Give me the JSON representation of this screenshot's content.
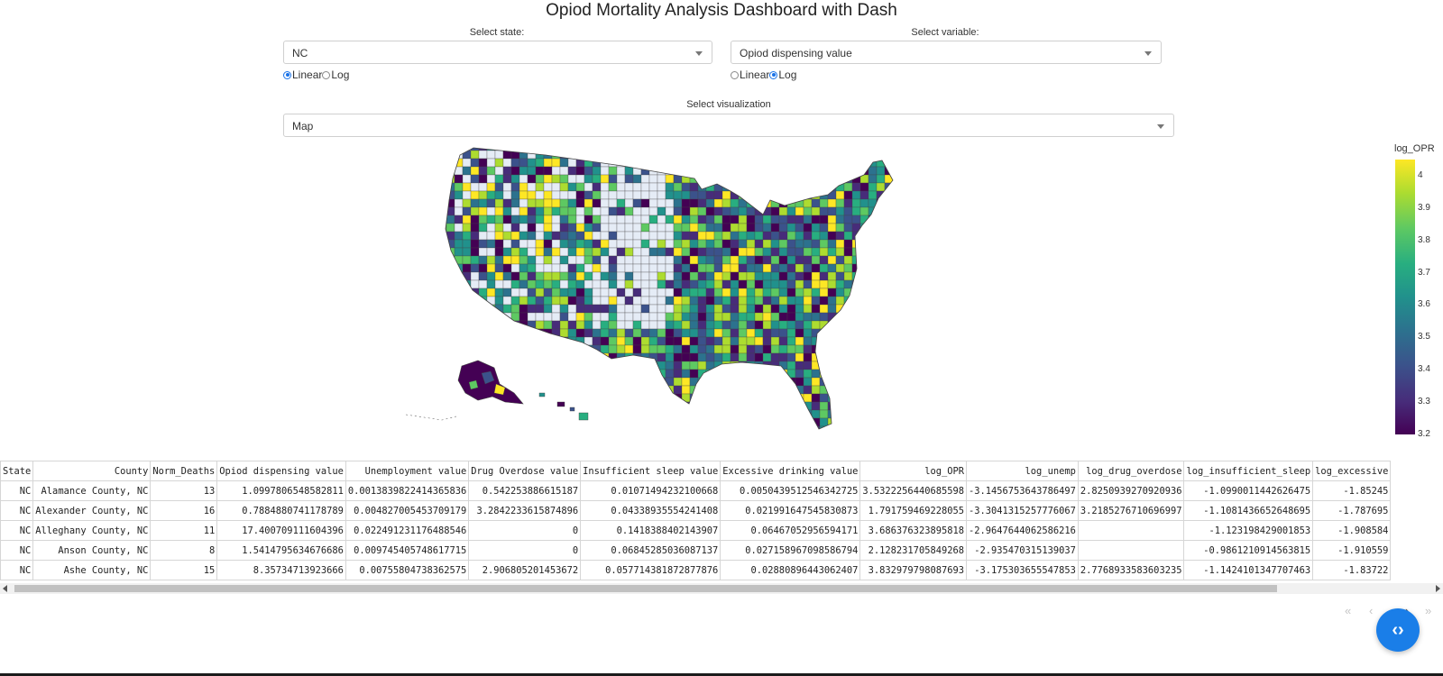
{
  "title": "Opiod Mortality Analysis Dashboard with Dash",
  "controls": {
    "state_label": "Select state:",
    "state_value": "NC",
    "variable_label": "Select variable:",
    "variable_value": "Opiod dispensing value",
    "state_scale": {
      "options": [
        "Linear",
        "Log"
      ],
      "selected": "Linear"
    },
    "variable_scale": {
      "options": [
        "Linear",
        "Log"
      ],
      "selected": "Log"
    },
    "viz_label": "Select visualization",
    "viz_value": "Map"
  },
  "map": {
    "type": "choropleth",
    "colorscale": "Viridis",
    "colorbar": {
      "title": "log_OPR",
      "ticks": [
        "4",
        "3.9",
        "3.8",
        "3.7",
        "3.6",
        "3.5",
        "3.4",
        "3.3",
        "3.2"
      ],
      "range": [
        3.2,
        4.05
      ]
    },
    "missing_color": "#e5ecf6",
    "border_color": "#444444"
  },
  "table": {
    "columns": [
      "State",
      "County",
      "Norm_Deaths",
      "Opiod dispensing value",
      "Unemployment value",
      "Drug Overdose value",
      "Insufficient sleep value",
      "Excessive drinking value",
      "log_OPR",
      "log_unemp",
      "log_drug_overdose",
      "log_insufficient_sleep",
      "log_excessive"
    ],
    "rows": [
      [
        "NC",
        "Alamance County, NC",
        "13",
        "1.0997806548582811",
        "0.0013839822414365836",
        "0.542253886615187",
        "0.01071494232100668",
        "0.0050439512546342725",
        "3.5322256440685598",
        "-3.1456753643786497",
        "2.8250939270920936",
        "-1.0990011442626475",
        "-1.85245"
      ],
      [
        "NC",
        "Alexander County, NC",
        "16",
        "0.7884880741178789",
        "0.004827005453709179",
        "3.2842233615874896",
        "0.04338935554241408",
        "0.021991647545830873",
        "1.791759469228055",
        "-3.3041315257776067",
        "3.2185276710696997",
        "-1.1081436652648695",
        "-1.787695"
      ],
      [
        "NC",
        "Alleghany County, NC",
        "11",
        "17.400709111604396",
        "0.022491231176488546",
        "0",
        "0.1418388402143907",
        "0.06467052956594171",
        "3.686376323895818",
        "-2.9647644062586216",
        "",
        "-1.123198429001853",
        "-1.908584"
      ],
      [
        "NC",
        "Anson County, NC",
        "8",
        "1.5414795634676686",
        "0.009745405748617715",
        "0",
        "0.06845285036087137",
        "0.027158967098586794",
        "2.128231705849268",
        "-2.935470315139037",
        "",
        "-0.9861210914563815",
        "-1.910559"
      ],
      [
        "NC",
        "Ashe County, NC",
        "15",
        "8.35734713923666",
        "0.00755804738362575",
        "2.906805201453672",
        "0.057714381872877876",
        "0.02880896443062407",
        "3.832979798087693",
        "-3.175303655547853",
        "2.7768933583603235",
        "-1.1424101347707463",
        "-1.83722"
      ]
    ]
  },
  "pager": {
    "first": "«",
    "prev": "‹",
    "next": "›",
    "last": "»"
  },
  "fab_icon": "code-icon"
}
